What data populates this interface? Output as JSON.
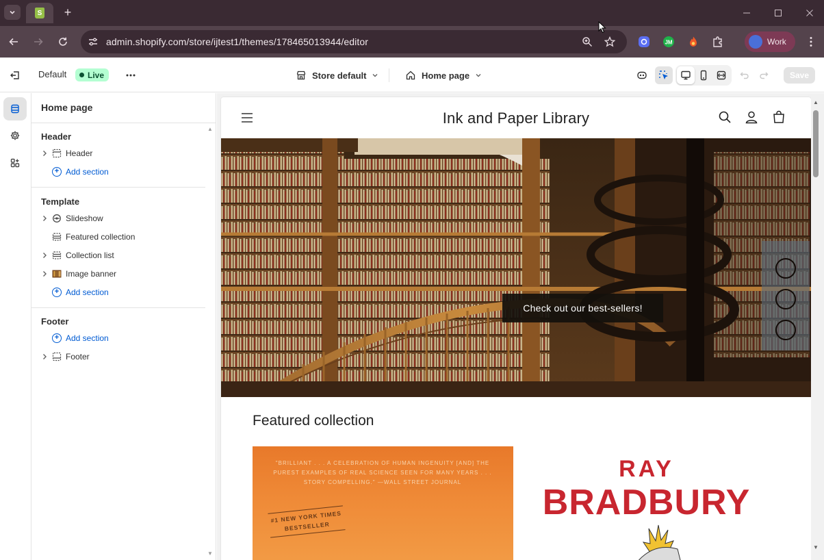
{
  "browser": {
    "url": "admin.shopify.com/store/ijtest1/themes/178465013944/editor",
    "profile_label": "Work",
    "tab_favicon": "shopify-icon",
    "extensions": [
      "puzzle-ext-icon",
      "jm-ext-icon",
      "flame-ext-icon",
      "extensions-puzzle-icon"
    ]
  },
  "editor": {
    "theme_name": "Default",
    "status_badge": "Live",
    "store_picker": "Store default",
    "page_picker": "Home page",
    "save_label": "Save"
  },
  "sidebar": {
    "title": "Home page",
    "groups": [
      {
        "title": "Header",
        "items": [
          {
            "label": "Header",
            "expandable": true,
            "icon": "header-section-icon"
          }
        ],
        "add_label": "Add section"
      },
      {
        "title": "Template",
        "items": [
          {
            "label": "Slideshow",
            "expandable": true,
            "icon": "slideshow-icon"
          },
          {
            "label": "Featured collection",
            "expandable": false,
            "icon": "collection-icon"
          },
          {
            "label": "Collection list",
            "expandable": true,
            "icon": "list-icon"
          },
          {
            "label": "Image banner",
            "expandable": true,
            "icon": "image-icon"
          }
        ],
        "add_label": "Add section"
      },
      {
        "title": "Footer",
        "add_label": "Add section",
        "items": [
          {
            "label": "Footer",
            "expandable": true,
            "icon": "footer-section-icon"
          }
        ]
      }
    ]
  },
  "preview": {
    "store_name": "Ink and Paper Library",
    "hero_button": "Check out our best-sellers!",
    "featured_title": "Featured collection",
    "book1": {
      "quote": "\"BRILLIANT . . . A CELEBRATION OF HUMAN INGENUITY [AND] THE PUREST EXAMPLES OF REAL SCIENCE SEEN FOR MANY YEARS . . . STORY COMPELLING.\" —WALL STREET JOURNAL",
      "badge": "#1 NEW YORK TIMES BESTSELLER"
    },
    "book2": {
      "line1": "RAY",
      "line2": "BRADBURY"
    }
  },
  "colors": {
    "tabstrip": "#3a2a33",
    "toolbar": "#54434c",
    "live_badge": "#b4fed2",
    "link_blue": "#005bd3",
    "bradbury_red": "#c8262f"
  }
}
